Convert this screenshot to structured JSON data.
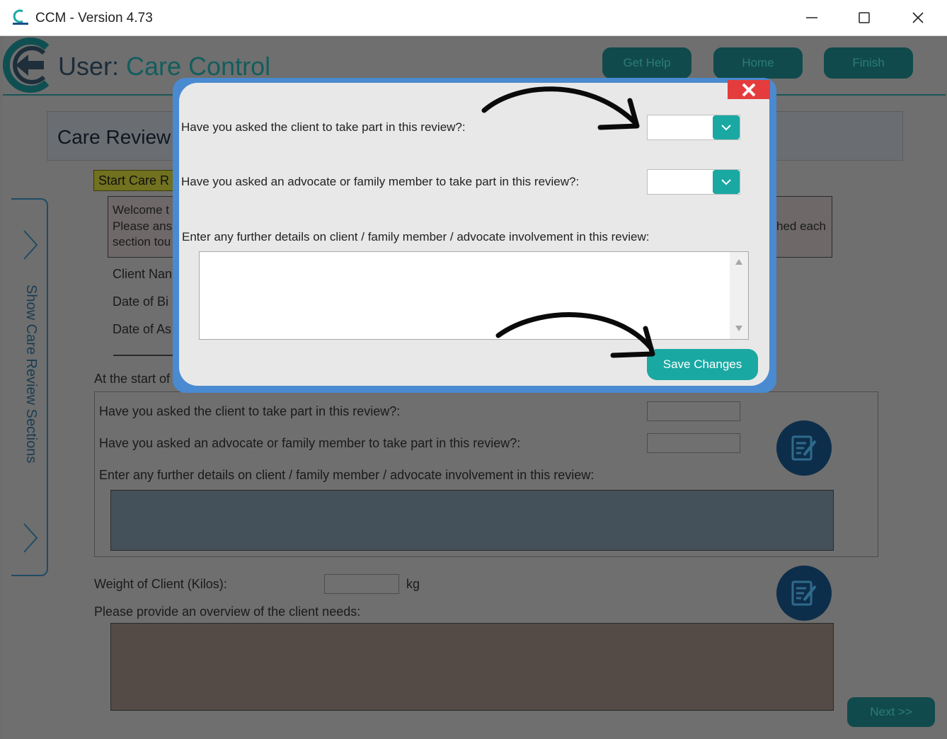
{
  "window": {
    "title": "CCM - Version 4.73"
  },
  "header": {
    "user_prefix": "User:",
    "user_name": "Care Control",
    "buttons": [
      "Get Help",
      "Home",
      "Finish"
    ]
  },
  "section": {
    "title": "Care Review"
  },
  "side_tab": {
    "label": "Show Care Review Sections"
  },
  "start": {
    "tag": "Start Care R",
    "welcome_lines": [
      "Welcome t",
      "Please ans",
      "section tou"
    ],
    "welcome_right": "hed each",
    "fields": [
      "Client Nan",
      "Date of Bi",
      "Date of As"
    ],
    "at_start": "At the start of"
  },
  "background_form": {
    "q1": "Have you asked the client to take part in this review?:",
    "q2": "Have you asked an advocate or family member to take part in this review?:",
    "q3": "Enter any further details on client / family member / advocate involvement in this review:"
  },
  "weight": {
    "label": "Weight of Client (Kilos):",
    "unit": "kg"
  },
  "overview": {
    "label": "Please provide an overview of the client needs:"
  },
  "next": {
    "label": "Next >>"
  },
  "modal": {
    "q1": "Have you asked the client to take part in this review?:",
    "q1_value": "",
    "q2": "Have you asked an advocate or family member to take part in this review?:",
    "q2_value": "",
    "q3": "Enter any further details on client / family member / advocate involvement in this review:",
    "details_value": "",
    "save_label": "Save Changes"
  },
  "colors": {
    "accent": "#1aa8a3",
    "close": "#e43c3c",
    "modal_frame": "#4a8ad0"
  }
}
